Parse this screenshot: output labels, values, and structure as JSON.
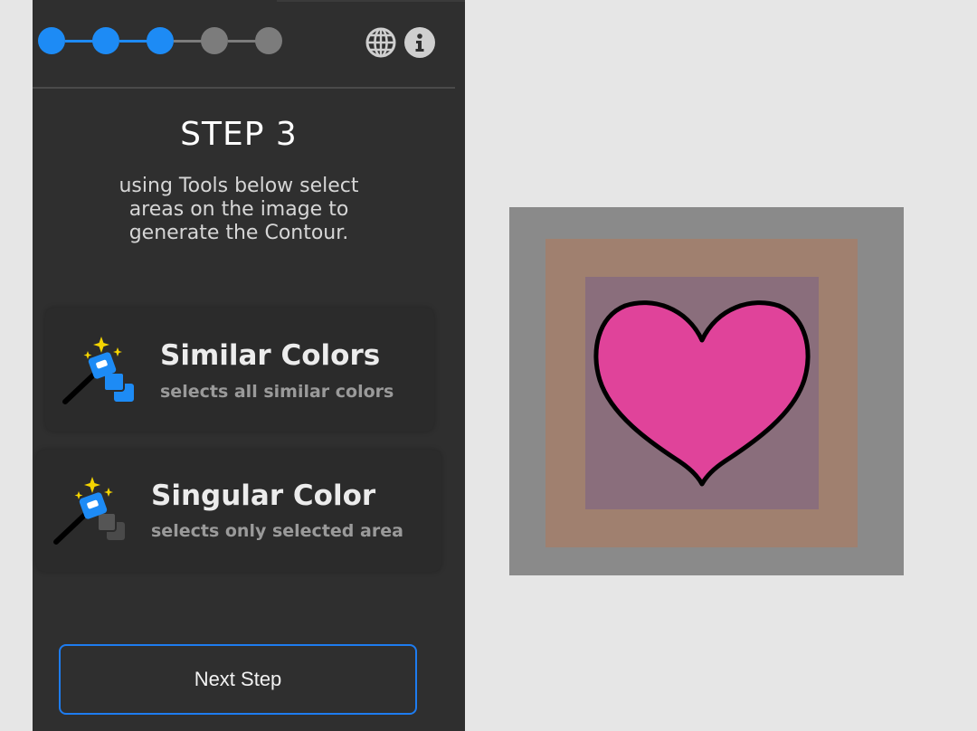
{
  "stepper": {
    "total": 5,
    "active": 3
  },
  "header": {
    "language_icon": "globe-icon",
    "info_icon": "info-icon"
  },
  "step": {
    "title": "STEP 3",
    "desc_line1": "using Tools below select",
    "desc_line2": "areas on the image to",
    "desc_line3": "generate the Contour."
  },
  "tools": [
    {
      "title": "Similar Colors",
      "subtitle": "selects all similar colors",
      "icon": "magic-wand-similar-icon"
    },
    {
      "title": "Singular Color",
      "subtitle": "selects only selected area",
      "icon": "magic-wand-singular-icon"
    }
  ],
  "next_button": {
    "label": "Next Step"
  },
  "colors": {
    "accent": "#1d8bf5",
    "panel": "#2f2f2f",
    "frame_outer": "#8a8a8a",
    "frame_middle": "#a0806f",
    "frame_inner": "#8a6e7c",
    "heart_fill": "#e0439a"
  }
}
